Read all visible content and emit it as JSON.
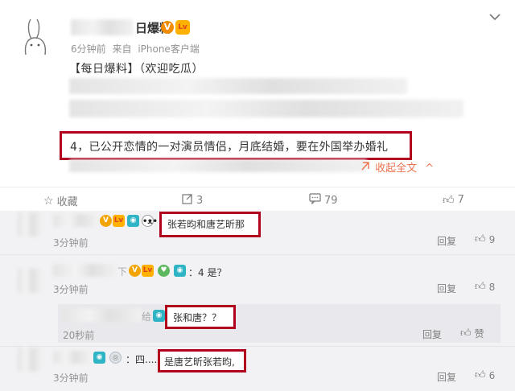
{
  "post": {
    "name_tail": "日爆料",
    "badge_v": "V",
    "badge_lv": "Lv",
    "meta_time": "6分钟前",
    "meta_from": "来自",
    "meta_device": "iPhone客户端",
    "head_line": "【每日爆料】（欢迎吃瓜）",
    "highlight_text": "4，已公开恋情的一对演员情侣，月底结婚，要在外国举办婚礼",
    "collapse_label": "收起全文",
    "collapse_arrow": "^",
    "more_icon": "chevron-down-icon"
  },
  "toolbar": {
    "favorite_label": "收藏",
    "repost_count": "3",
    "comment_count": "79",
    "like_count": "7"
  },
  "comments": [
    {
      "text": "张若昀和唐艺昕那",
      "time": "3分钟前",
      "reply_label": "回复",
      "likes": "9"
    },
    {
      "name_tail": "下",
      "text": "：4 是？",
      "time": "3分钟前",
      "reply_label": "回复",
      "likes": "8"
    },
    {
      "name_tail": "给",
      "text": "张和唐？？",
      "time": "20秒前",
      "reply_label": "回复",
      "likes": "赞"
    },
    {
      "prefix": "：四......",
      "text": "是唐艺昕张若昀,",
      "time": "3分钟前",
      "reply_label": "回复",
      "likes": "6"
    }
  ]
}
